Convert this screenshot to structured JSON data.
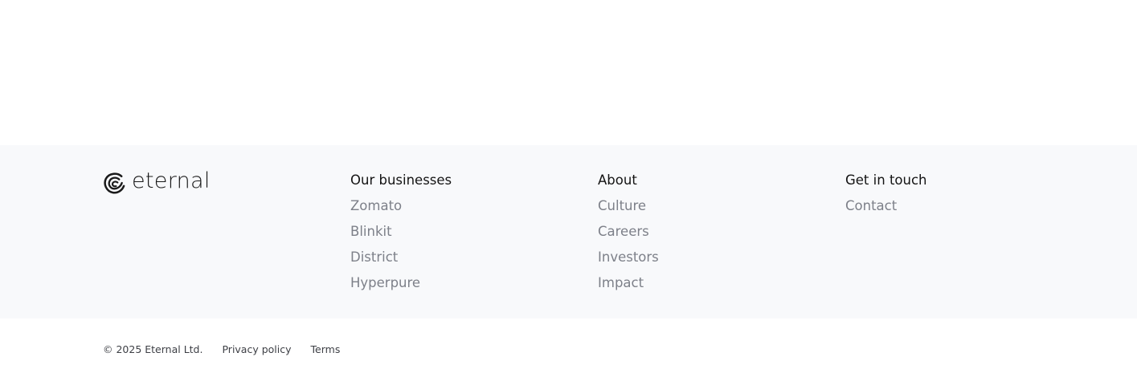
{
  "brand": {
    "name": "eternal",
    "logo_icon": "eternal-swirl-icon"
  },
  "footer": {
    "columns": [
      {
        "heading": "Our businesses",
        "links": [
          "Zomato",
          "Blinkit",
          "District",
          "Hyperpure"
        ]
      },
      {
        "heading": "About",
        "links": [
          "Culture",
          "Careers",
          "Investors",
          "Impact"
        ]
      },
      {
        "heading": "Get in touch",
        "links": [
          "Contact"
        ]
      }
    ]
  },
  "bottom": {
    "copyright": "© 2025 Eternal Ltd.",
    "privacy_label": "Privacy policy",
    "terms_label": "Terms"
  },
  "colors": {
    "footer_bg": "#f8f9fb",
    "heading": "#141414",
    "link": "#7d8089"
  }
}
